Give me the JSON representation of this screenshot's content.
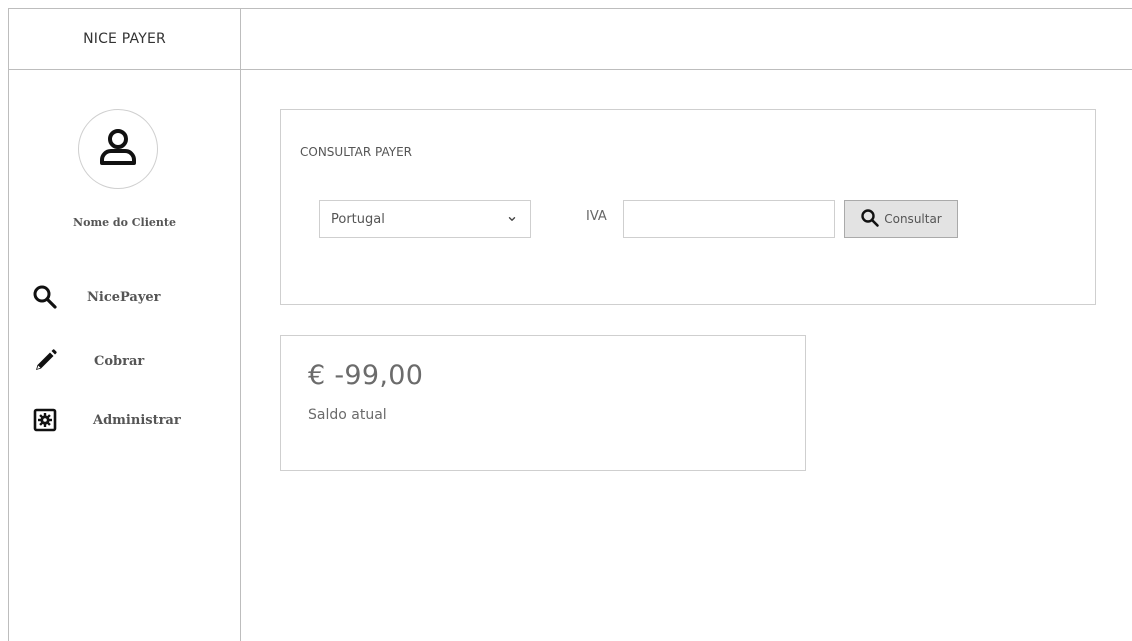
{
  "app": {
    "brand": "NICE PAYER"
  },
  "sidebar": {
    "client_name": "Nome do Cliente",
    "items": [
      {
        "label": "NicePayer",
        "icon": "search-icon"
      },
      {
        "label": "Cobrar",
        "icon": "pencil-icon"
      },
      {
        "label": "Administrar",
        "icon": "settings-box-icon"
      }
    ]
  },
  "search": {
    "title": "CONSULTAR PAYER",
    "country_selected": "Portugal",
    "iva_label": "IVA",
    "iva_value": "",
    "button_label": "Consultar"
  },
  "balance": {
    "amount": "€ -99,00",
    "caption": "Saldo atual"
  },
  "colors": {
    "border": "#cfcfcf",
    "button_bg": "#e3e3e3",
    "text": "#333333",
    "muted_text": "#6b6b6b"
  }
}
